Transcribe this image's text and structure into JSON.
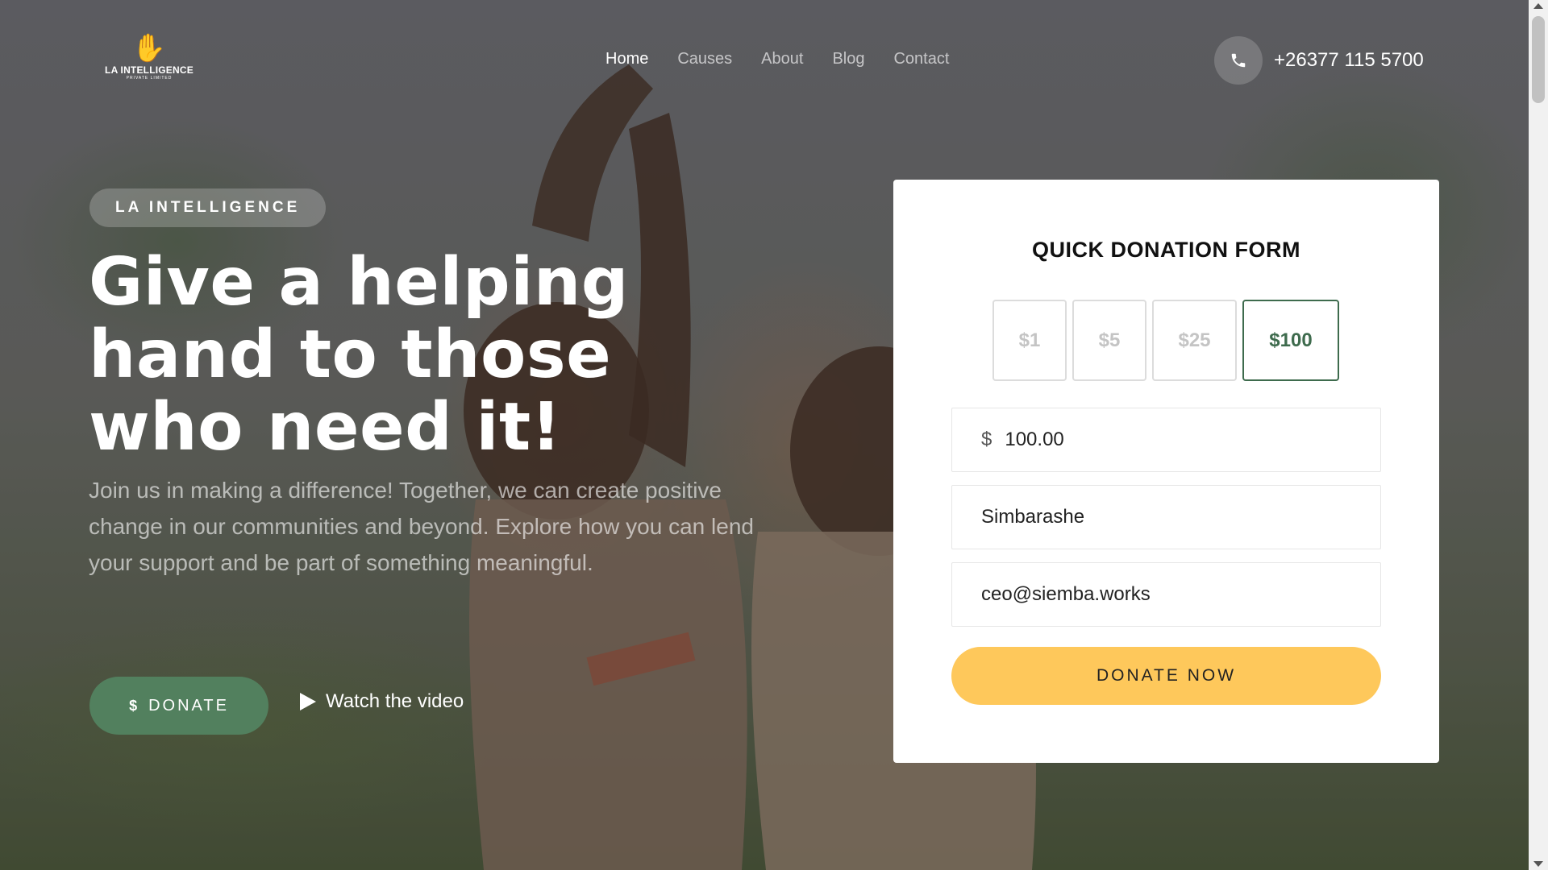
{
  "brand": {
    "logo_name": "LA INTELLIGENCE",
    "logo_tagline": "PRIVATE LIMITED"
  },
  "nav": {
    "items": [
      {
        "label": "Home",
        "active": true
      },
      {
        "label": "Causes",
        "active": false
      },
      {
        "label": "About",
        "active": false
      },
      {
        "label": "Blog",
        "active": false
      },
      {
        "label": "Contact",
        "active": false
      }
    ]
  },
  "header": {
    "phone_icon": "phone-icon",
    "phone_number": "+26377 115 5700"
  },
  "hero": {
    "pill": "LA INTELLIGENCE",
    "headline_line1": "Give a helping",
    "headline_line2": "hand to those",
    "headline_line3": "who need it!",
    "subtext": "Join us in making a difference! Together, we can create positive change in our communities and beyond. Explore how you can lend your support and be part of something meaningful.",
    "donate_icon": "$",
    "donate_label": "DONATE",
    "watch_label": "Watch the video"
  },
  "donation_form": {
    "title": "QUICK DONATION FORM",
    "amounts": [
      "$1",
      "$5",
      "$25",
      "$100"
    ],
    "selected_amount": "$100",
    "currency_symbol": "$",
    "amount_value": "100.00",
    "name_value": "Simbarashe",
    "email_value": "ceo@siemba.works",
    "submit_label": "DONATE NOW"
  },
  "colors": {
    "accent_green": "#52805e",
    "selected_green": "#3e6b4d",
    "button_yellow": "#fec85b"
  }
}
